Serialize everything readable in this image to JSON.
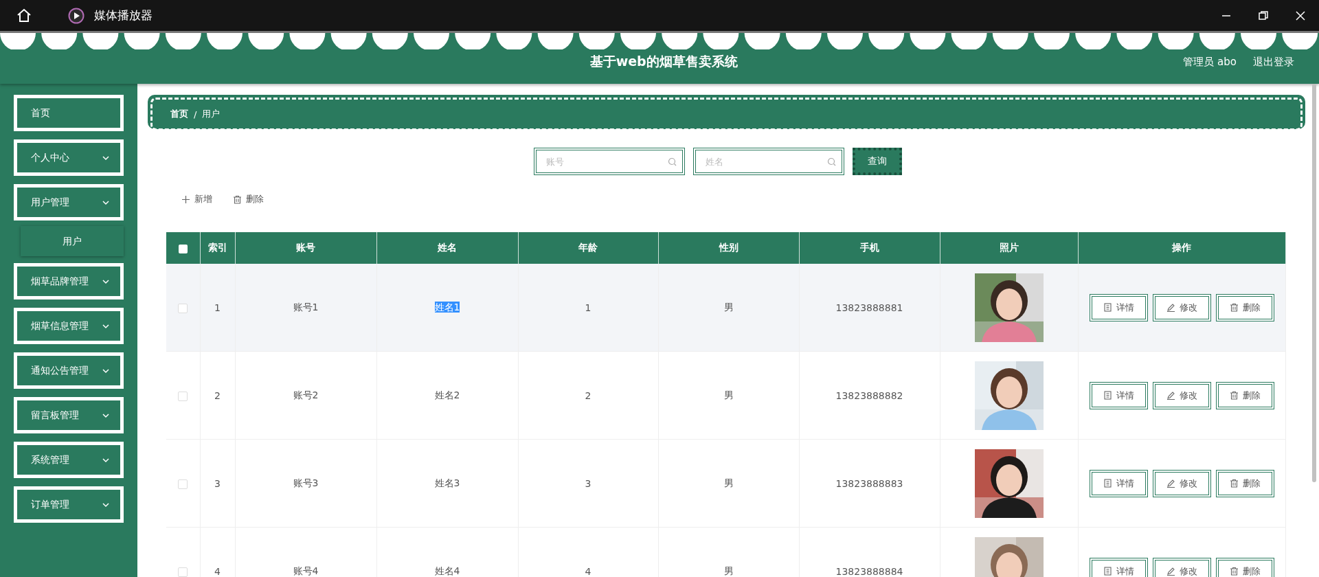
{
  "window": {
    "title": "媒体播放器"
  },
  "header": {
    "title": "基于web的烟草售卖系统",
    "user": "管理员 abo",
    "logout": "退出登录"
  },
  "sidebar": {
    "items": [
      {
        "label": "首页",
        "kind": "link"
      },
      {
        "label": "个人中心",
        "kind": "menu"
      },
      {
        "label": "用户管理",
        "kind": "menu",
        "expanded": true,
        "children": [
          {
            "label": "用户"
          }
        ]
      },
      {
        "label": "烟草品牌管理",
        "kind": "menu"
      },
      {
        "label": "烟草信息管理",
        "kind": "menu"
      },
      {
        "label": "通知公告管理",
        "kind": "menu"
      },
      {
        "label": "留言板管理",
        "kind": "menu"
      },
      {
        "label": "系统管理",
        "kind": "menu"
      },
      {
        "label": "订单管理",
        "kind": "menu"
      }
    ]
  },
  "breadcrumb": [
    "首页",
    "用户"
  ],
  "breadcrumb_separator": "/",
  "search": {
    "fields": [
      {
        "placeholder": "账号"
      },
      {
        "placeholder": "姓名"
      }
    ],
    "button": "查询"
  },
  "actions": [
    {
      "label": "新增",
      "kind": "add"
    },
    {
      "label": "删除",
      "kind": "delete"
    }
  ],
  "table": {
    "columns": [
      "索引",
      "账号",
      "姓名",
      "年龄",
      "性别",
      "手机",
      "照片",
      "操作"
    ],
    "header_checked": false,
    "rows": [
      {
        "checked": false,
        "highlighted": true,
        "name_selected": true,
        "cells": [
          "1",
          "账号1",
          "姓名1",
          "1",
          "男",
          "13823888881"
        ],
        "photo": {
          "kind": "picture"
        },
        "buttons": [
          {
            "label": "详情",
            "kind": "detail"
          },
          {
            "label": "修改",
            "kind": "edit"
          },
          {
            "label": "删除",
            "kind": "delete"
          }
        ]
      },
      {
        "checked": false,
        "highlighted": false,
        "name_selected": false,
        "cells": [
          "2",
          "账号2",
          "姓名2",
          "2",
          "男",
          "13823888882"
        ],
        "photo": {
          "kind": "picture"
        },
        "buttons": [
          {
            "label": "详情",
            "kind": "detail"
          },
          {
            "label": "修改",
            "kind": "edit"
          },
          {
            "label": "删除",
            "kind": "delete"
          }
        ]
      },
      {
        "checked": false,
        "highlighted": false,
        "name_selected": false,
        "cells": [
          "3",
          "账号3",
          "姓名3",
          "3",
          "男",
          "13823888883"
        ],
        "photo": {
          "kind": "picture"
        },
        "buttons": [
          {
            "label": "详情",
            "kind": "detail"
          },
          {
            "label": "修改",
            "kind": "edit"
          },
          {
            "label": "删除",
            "kind": "delete"
          }
        ]
      },
      {
        "checked": false,
        "highlighted": false,
        "name_selected": false,
        "cells": [
          "4",
          "账号4",
          "姓名4",
          "4",
          "男",
          "13823888884"
        ],
        "photo": {
          "kind": "picture"
        },
        "buttons": [
          {
            "label": "详情",
            "kind": "detail"
          },
          {
            "label": "修改",
            "kind": "edit"
          },
          {
            "label": "删除",
            "kind": "delete"
          }
        ]
      }
    ]
  }
}
